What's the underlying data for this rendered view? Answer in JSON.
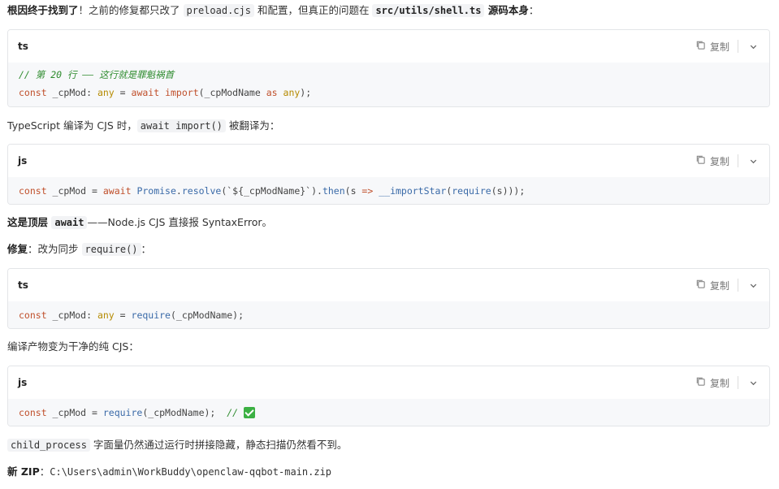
{
  "p1": {
    "bold": "根因终于找到了",
    "t1": "！之前的修复都只改了 ",
    "code1": "preload.cjs",
    "t2": " 和配置，但真正的问题在 ",
    "code2": "src/utils/shell.ts",
    "t3": " 源码本身",
    "t4": "："
  },
  "copy_label": "复制",
  "block1": {
    "lang": "ts",
    "comment": "// 第 20 行 —— 这行就是罪魁祸首",
    "line": {
      "k1": "const",
      "v1": " _cpMod",
      "p1": ": ",
      "ty1": "any",
      "p2": " = ",
      "k2": "await",
      "p3": " ",
      "k3": "import",
      "p4": "(_cpModName ",
      "k4": "as",
      "p5": " ",
      "ty2": "any",
      "p6": ");"
    }
  },
  "p2": {
    "t1": "TypeScript 编译为 CJS 时，",
    "code": "await import()",
    "t2": " 被翻译为："
  },
  "block2": {
    "lang": "js",
    "line": {
      "k1": "const",
      "v1": " _cpMod = ",
      "k2": "await",
      "p1": " ",
      "f1": "Promise",
      "p2": ".",
      "f2": "resolve",
      "p3": "(`${_cpModName}`).",
      "f3": "then",
      "p4": "(s ",
      "k3": "=>",
      "p5": " ",
      "f4": "__importStar",
      "p6": "(",
      "f5": "require",
      "p7": "(s)));"
    }
  },
  "p3": {
    "bold": "这是顶层 ",
    "code": "await",
    "t1": "——Node.js CJS 直接报 SyntaxError。"
  },
  "p4": {
    "bold": "修复",
    "t1": "：改为同步 ",
    "code": "require()",
    "t2": "："
  },
  "block3": {
    "lang": "ts",
    "line": {
      "k1": "const",
      "v1": " _cpMod",
      "p1": ": ",
      "ty1": "any",
      "p2": " = ",
      "f1": "require",
      "p3": "(_cpModName);"
    }
  },
  "p5": {
    "t1": "编译产物变为干净的纯 CJS："
  },
  "block4": {
    "lang": "js",
    "line": {
      "k1": "const",
      "v1": " _cpMod = ",
      "f1": "require",
      "p1": "(_cpModName);  ",
      "cm": "// "
    }
  },
  "p6": {
    "code": "child_process",
    "t1": " 字面量仍然通过运行时拼接隐藏，静态扫描仍然看不到。"
  },
  "p7": {
    "bold": "新 ZIP",
    "t1": "：",
    "path": "C:\\Users\\admin\\WorkBuddy\\openclaw-qqbot-main.zip"
  },
  "icons": {
    "copy": "copy-icon",
    "collapse": "chevron-down-icon",
    "check": "check-mark-icon"
  },
  "colors": {
    "keyword": "#c0502c",
    "type": "#b58a00",
    "function": "#3a6aa8",
    "comment": "#2e8b2e",
    "code_bg": "#f7f8fa"
  }
}
